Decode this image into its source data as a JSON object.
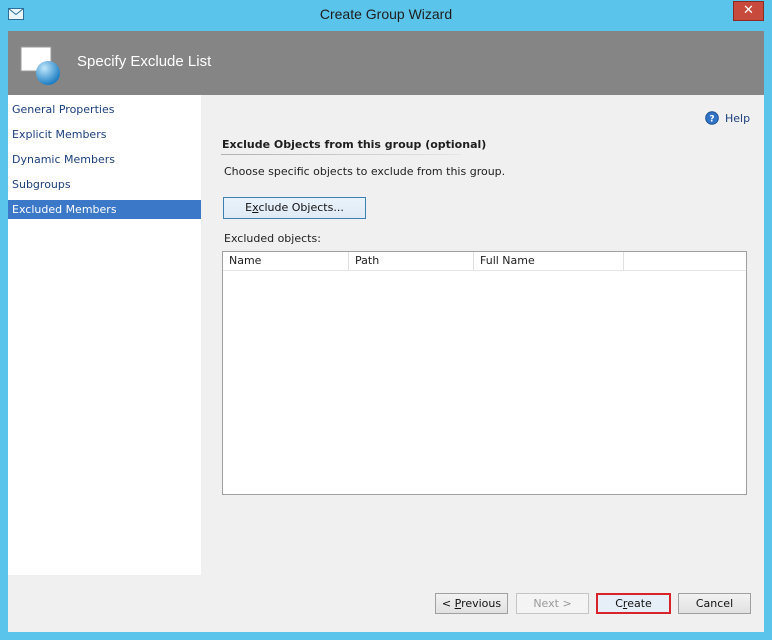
{
  "window": {
    "title": "Create Group Wizard",
    "close_label": "✕"
  },
  "header": {
    "title": "Specify Exclude List"
  },
  "nav": {
    "items": [
      {
        "label": "General Properties",
        "selected": false
      },
      {
        "label": "Explicit Members",
        "selected": false
      },
      {
        "label": "Dynamic Members",
        "selected": false
      },
      {
        "label": "Subgroups",
        "selected": false
      },
      {
        "label": "Excluded Members",
        "selected": true
      }
    ]
  },
  "main": {
    "help_label": "Help",
    "section_title": "Exclude Objects from this group (optional)",
    "section_desc": "Choose specific objects to exclude from this group.",
    "exclude_button": {
      "mnemonic": "x",
      "pre": "E",
      "post": "clude Objects..."
    },
    "list_label": "Excluded objects:",
    "columns": [
      "Name",
      "Path",
      "Full Name"
    ],
    "rows": []
  },
  "footer": {
    "previous": {
      "mnemonic": "P",
      "pre": "< ",
      "post": "revious",
      "enabled": true
    },
    "next": {
      "label": "Next >",
      "enabled": false
    },
    "create": {
      "mnemonic": "r",
      "pre": "C",
      "post": "eate",
      "highlighted": true
    },
    "cancel": {
      "label": "Cancel"
    }
  },
  "colors": {
    "titlebar": "#5bc4ea",
    "header": "#858585",
    "nav_selected": "#3b79c8",
    "close_button": "#c74a3d",
    "create_highlight": "#d8232a"
  }
}
